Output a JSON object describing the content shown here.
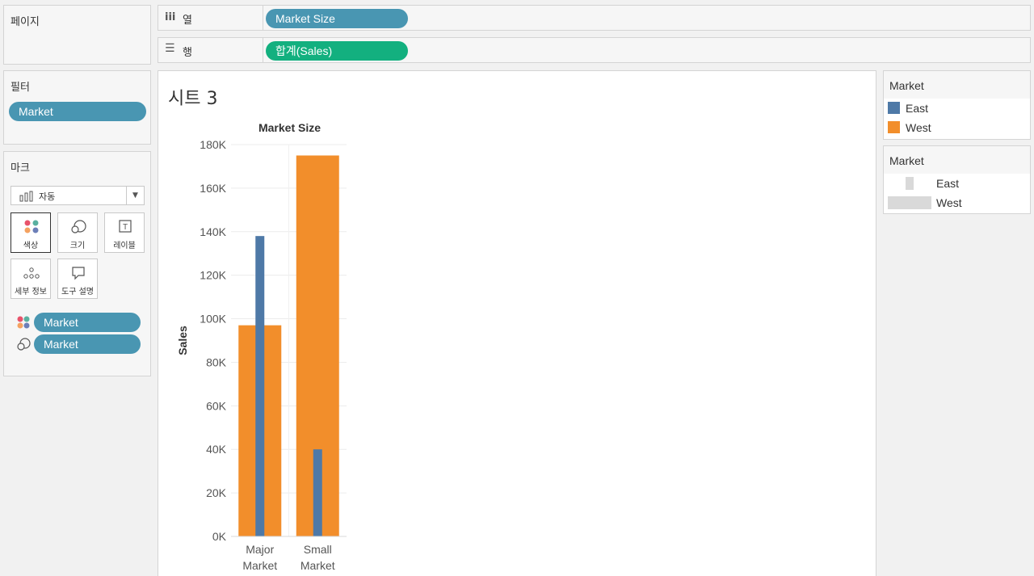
{
  "pages_panel": {
    "title": "페이지"
  },
  "columns_shelf": {
    "label": "열",
    "pill": "Market Size"
  },
  "rows_shelf": {
    "label": "행",
    "pill": "합계(Sales)"
  },
  "filters_panel": {
    "title": "필터",
    "pill": "Market"
  },
  "marks_panel": {
    "title": "마크",
    "mark_type": "자동",
    "buttons": [
      {
        "label": "색상",
        "icon": "color-dots-icon"
      },
      {
        "label": "크기",
        "icon": "size-circles-icon"
      },
      {
        "label": "레이블",
        "icon": "label-t-icon"
      },
      {
        "label": "세부 정보",
        "icon": "detail-dots-icon"
      },
      {
        "label": "도구 설명",
        "icon": "tooltip-bubble-icon"
      }
    ],
    "fields": [
      {
        "label": "Market",
        "icon": "color-dots-icon"
      },
      {
        "label": "Market",
        "icon": "size-circles-icon"
      }
    ]
  },
  "sheet": {
    "title": "시트 3"
  },
  "color_legend": {
    "title": "Market",
    "items": [
      {
        "label": "East",
        "color": "#4e79a7"
      },
      {
        "label": "West",
        "color": "#f28e2b"
      }
    ]
  },
  "size_legend": {
    "title": "Market",
    "items": [
      {
        "label": "East"
      },
      {
        "label": "West"
      }
    ]
  },
  "chart_data": {
    "type": "bar",
    "title": "Market Size",
    "xlabel": "",
    "ylabel": "Sales",
    "categories": [
      "Major Market",
      "Small Market"
    ],
    "category_lines": [
      [
        "Major",
        "Market"
      ],
      [
        "Small",
        "Market"
      ]
    ],
    "ylim": [
      0,
      180000
    ],
    "yticks": [
      0,
      20000,
      40000,
      60000,
      80000,
      100000,
      120000,
      140000,
      160000,
      180000
    ],
    "ytick_labels": [
      "0K",
      "20K",
      "40K",
      "60K",
      "80K",
      "100K",
      "120K",
      "140K",
      "160K",
      "180K"
    ],
    "series": [
      {
        "name": "West",
        "color": "#f28e2b",
        "values": [
          97000,
          175000
        ]
      },
      {
        "name": "East",
        "color": "#4e79a7",
        "values": [
          138000,
          40000
        ]
      }
    ],
    "grid": true
  }
}
